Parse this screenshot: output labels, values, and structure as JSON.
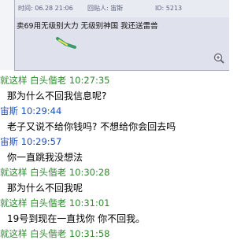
{
  "screenshot": {
    "header": {
      "time_label": "时间: 06.28 21:06",
      "replier_label": "回贴人: 宙斯",
      "id_label": "ID: 5213"
    },
    "message": "卖69用无级别大力 无级别神国 我还送雷兽",
    "zoom_icon": "zoom-in-icon"
  },
  "messages": [
    {
      "sender": "就这样 白头偕老",
      "time": "10:27:35",
      "text": "那为什么不回我信息呢?",
      "color": "#2f8a2f"
    },
    {
      "sender": "宙斯",
      "time": "10:29:44",
      "text": "老子又说不给你钱吗? 不想给你会回去吗",
      "color": "#1f4fb8"
    },
    {
      "sender": "宙斯",
      "time": "10:29:57",
      "text": "你一直跳我没想法",
      "color": "#1f4fb8"
    },
    {
      "sender": "就这样 白头偕老",
      "time": "10:30:28",
      "text": "那为什么不回我呢",
      "color": "#2f8a2f"
    },
    {
      "sender": "就这样 白头偕老",
      "time": "10:31:01",
      "text": "19号到现在一直找你 你不回我。",
      "color": "#2f8a2f"
    },
    {
      "sender": "就这样 白头偕老",
      "time": "10:31:58",
      "text": "",
      "color": "#2f8a2f"
    }
  ]
}
